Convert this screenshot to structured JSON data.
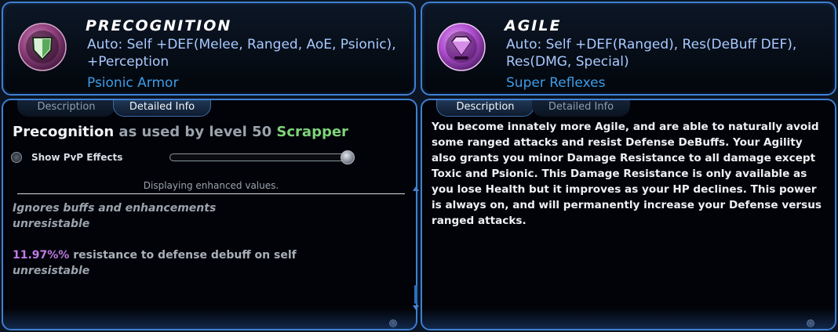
{
  "left": {
    "title": "PRECOGNITION",
    "description": "Auto: Self +DEF(Melee, Ranged, AoE, Psionic), +Perception",
    "powerset": "Psionic Armor",
    "tabs": [
      "Description",
      "Detailed Info"
    ],
    "active_tab": "Detailed Info",
    "info": {
      "power_name": "Precognition",
      "used_by": "as used by level 50",
      "archetype": "Scrapper",
      "pvp_label": "Show PvP Effects",
      "enhanced_note": "Displaying enhanced values.",
      "line1": "Ignores buffs and enhancements",
      "line2": "unresistable",
      "value": "11.97%%",
      "effect": "resistance to defense debuff on self",
      "line4": "unresistable"
    }
  },
  "right": {
    "title": "AGILE",
    "description": "Auto: Self +DEF(Ranged), Res(DeBuff DEF), Res(DMG, Special)",
    "powerset": "Super Reflexes",
    "tabs": [
      "Description",
      "Detailed Info"
    ],
    "active_tab": "Description",
    "body": "You become innately more Agile, and are able to naturally avoid some ranged attacks and resist Defense DeBuffs. Your Agility also grants you minor Damage Resistance to all damage except Toxic and Psionic. This Damage Resistance is only available as you lose Health but it improves as your HP declines. This power is always on, and will permanently increase your Defense versus ranged attacks."
  },
  "colors": {
    "border": "#3f7fd2",
    "archetype": "#7ed37a",
    "value": "#c07ae6",
    "powerset": "#3e9ce6"
  },
  "icons": [
    "shield-power-icon",
    "gem-power-icon",
    "radio-icon",
    "slider-knob-icon",
    "close-icon",
    "scroll-up-icon",
    "scroll-down-icon"
  ]
}
